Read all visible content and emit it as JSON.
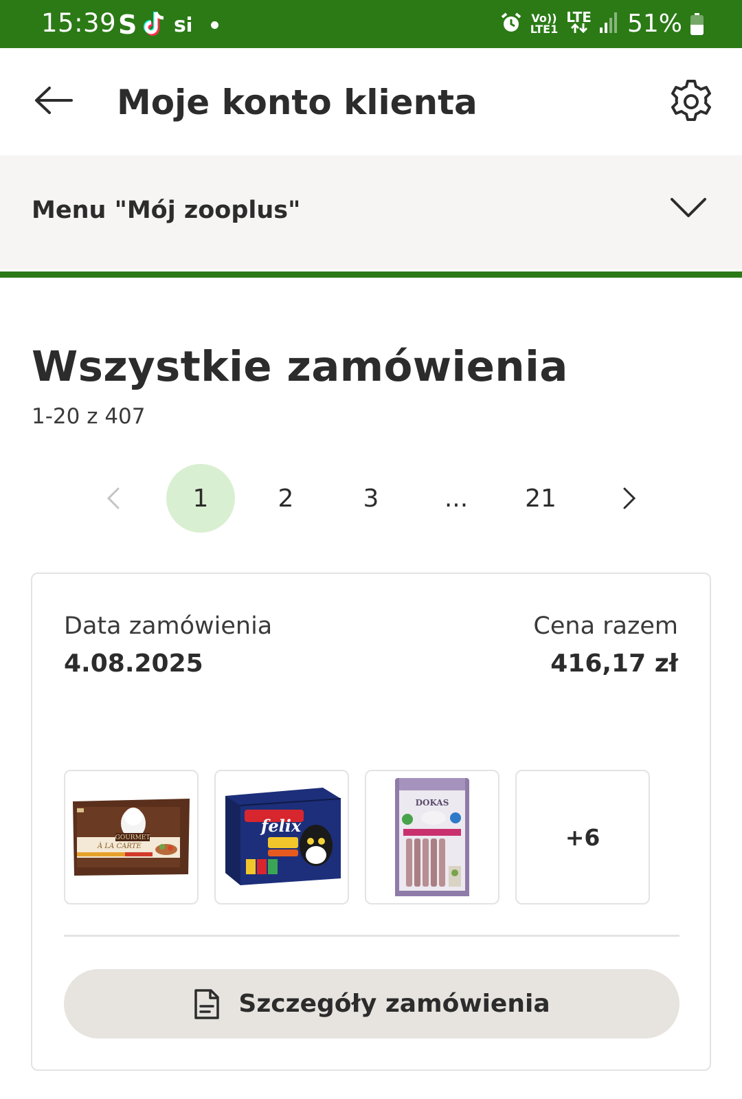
{
  "status_bar": {
    "time": "15:39",
    "left_icons": [
      "s-app-icon",
      "tiktok-icon",
      "si-app-icon",
      "notification-dot"
    ],
    "right_icons": [
      "alarm-icon",
      "volte-icon",
      "lte-icon",
      "signal-icon"
    ],
    "volte_label_top": "Vo))",
    "volte_label_bottom": "LTE1",
    "lte_label": "LTE",
    "battery_percent": "51%",
    "battery_level": 0.51,
    "background_color": "#2b7a16"
  },
  "header": {
    "title": "Moje konto klienta",
    "back_icon": "arrow-left-icon",
    "settings_icon": "gear-icon"
  },
  "account_menu": {
    "label": "Menu \"Mój zooplus\"",
    "chevron_icon": "chevron-down-icon",
    "accent_color": "#2b7a16"
  },
  "orders": {
    "heading": "Wszystkie zamówienia",
    "range_text": "1-20 z 407"
  },
  "pagination": {
    "pages": [
      "1",
      "2",
      "3",
      "...",
      "21"
    ],
    "active_page": "1",
    "prev_icon": "chevron-left-icon",
    "next_icon": "chevron-right-icon",
    "active_color": "#d9efd1"
  },
  "order_card": {
    "date_label": "Data zamówienia",
    "date_value": "4.08.2025",
    "total_label": "Cena razem",
    "total_value": "416,17 zł",
    "products": [
      {
        "name": "gourmet-a-la-carte-pack",
        "brand_text": "GOURMET"
      },
      {
        "name": "felix-doppelt-lecker-box",
        "brand_text": "felix"
      },
      {
        "name": "dokas-rabbit-sticks-bag",
        "brand_text": "DOKAS"
      }
    ],
    "more_count": "+6",
    "details_button": "Szczegóły zamówienia",
    "details_icon": "document-icon"
  }
}
